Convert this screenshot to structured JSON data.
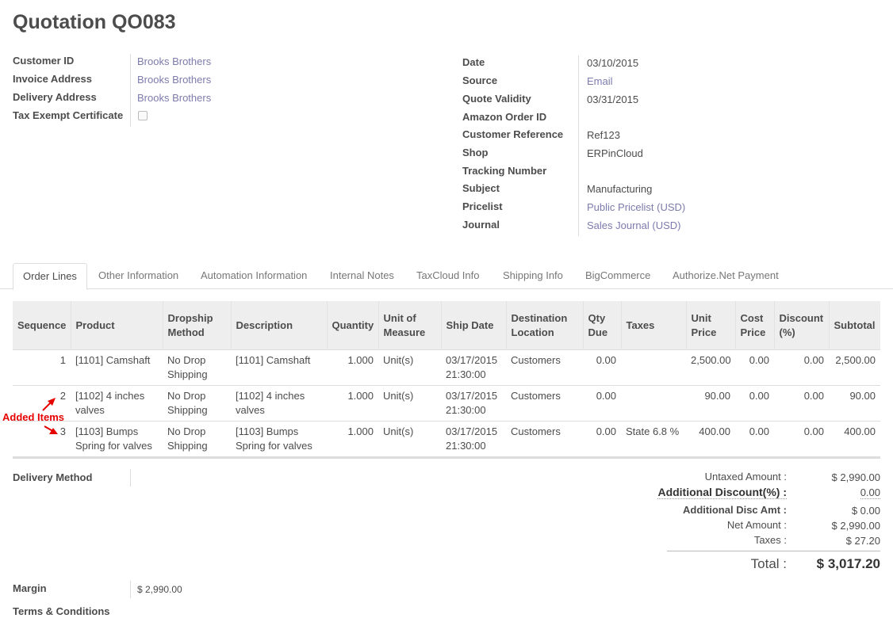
{
  "title": "Quotation QO083",
  "left_fields": [
    {
      "label": "Customer ID",
      "value": "Brooks Brothers",
      "link": true
    },
    {
      "label": "Invoice Address",
      "value": "Brooks Brothers",
      "link": true
    },
    {
      "label": "Delivery Address",
      "value": "Brooks Brothers",
      "link": true
    },
    {
      "label": "Tax Exempt Certificate",
      "value": "",
      "link": false
    }
  ],
  "right_fields": [
    {
      "label": "Date",
      "value": "03/10/2015",
      "link": false
    },
    {
      "label": "Source",
      "value": "Email",
      "link": true
    },
    {
      "label": "Quote Validity",
      "value": "03/31/2015",
      "link": false
    },
    {
      "label": "Amazon Order ID",
      "value": "",
      "link": false
    },
    {
      "label": "Customer Reference",
      "value": "Ref123",
      "link": false
    },
    {
      "label": "Shop",
      "value": "ERPinCloud",
      "link": false
    },
    {
      "label": "Tracking Number",
      "value": "",
      "link": false
    },
    {
      "label": "Subject",
      "value": "Manufacturing",
      "link": false
    },
    {
      "label": "Pricelist",
      "value": "Public Pricelist (USD)",
      "link": true
    },
    {
      "label": "Journal",
      "value": "Sales Journal (USD)",
      "link": true
    }
  ],
  "tabs": [
    "Order Lines",
    "Other Information",
    "Automation Information",
    "Internal Notes",
    "TaxCloud Info",
    "Shipping Info",
    "BigCommerce",
    "Authorize.Net Payment"
  ],
  "columns": [
    "Sequence",
    "Product",
    "Dropship Method",
    "Description",
    "Quantity",
    "Unit of Measure",
    "Ship Date",
    "Destination Location",
    "Qty Due",
    "Taxes",
    "Unit Price",
    "Cost Price",
    "Discount (%)",
    "Subtotal"
  ],
  "rows": [
    [
      "1",
      "[1101] Camshaft",
      "No Drop Shipping",
      "[1101] Camshaft",
      "1.000",
      "Unit(s)",
      "03/17/2015 21:30:00",
      "Customers",
      "0.00",
      "",
      "2,500.00",
      "0.00",
      "0.00",
      "2,500.00"
    ],
    [
      "2",
      "[1102] 4 inches valves",
      "No Drop Shipping",
      "[1102] 4 inches valves",
      "1.000",
      "Unit(s)",
      "03/17/2015 21:30:00",
      "Customers",
      "0.00",
      "",
      "90.00",
      "0.00",
      "0.00",
      "90.00"
    ],
    [
      "3",
      "[1103] Bumps Spring for valves",
      "No Drop Shipping",
      "[1103] Bumps Spring for valves",
      "1.000",
      "Unit(s)",
      "03/17/2015 21:30:00",
      "Customers",
      "0.00",
      "State 6.8 %",
      "400.00",
      "0.00",
      "0.00",
      "400.00"
    ]
  ],
  "annotation": "Added Items",
  "delivery_method_label": "Delivery Method",
  "totals": {
    "untaxed_label": "Untaxed Amount :",
    "untaxed": "$ 2,990.00",
    "add_disc_pct_label": "Additional Discount(%) :",
    "add_disc_pct": "0.00",
    "add_disc_amt_label": "Additional Disc Amt :",
    "add_disc_amt": "$ 0.00",
    "net_label": "Net Amount :",
    "net": "$ 2,990.00",
    "taxes_label": "Taxes :",
    "taxes": "$ 27.20",
    "total_label": "Total :",
    "total": "$ 3,017.20"
  },
  "margin_label": "Margin",
  "margin_value": "$ 2,990.00",
  "terms_label": "Terms & Conditions",
  "colors": {
    "link": "#7c7bad",
    "annotation": "#e60000",
    "header_bg": "#eeeeee"
  }
}
